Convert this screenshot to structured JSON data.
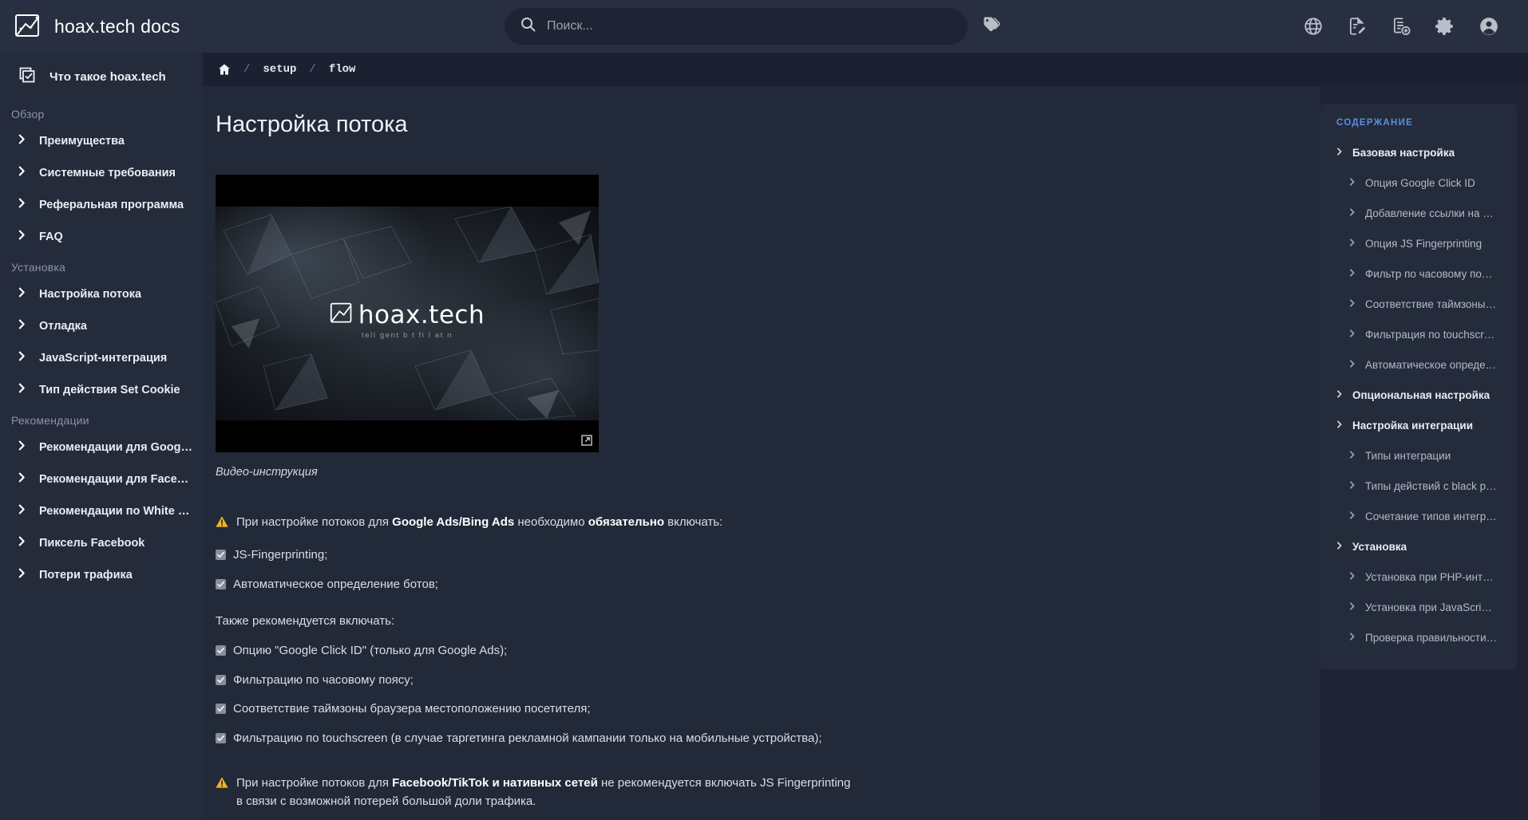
{
  "header": {
    "brand_title": "hoax.tech docs",
    "logo_icon": "image-chart-logo-icon",
    "search": {
      "placeholder": "Поиск...",
      "value": "",
      "icon": "search-icon"
    },
    "tags_icon": "tags-icon",
    "icons": [
      {
        "name": "language-globe-icon",
        "label": "Язык"
      },
      {
        "name": "edit-document-icon",
        "label": "Редактировать"
      },
      {
        "name": "add-document-icon",
        "label": "Добавить"
      },
      {
        "name": "gear-icon",
        "label": "Настройки"
      },
      {
        "name": "account-icon",
        "label": "Аккаунт"
      }
    ]
  },
  "breadcrumb": {
    "home_icon": "home-icon",
    "separator": "/",
    "items": [
      {
        "label": "setup"
      },
      {
        "label": "flow"
      }
    ]
  },
  "sidebar": {
    "top_item": {
      "label": "Что такое hoax.tech",
      "icon": "checklist-icon"
    },
    "sections": [
      {
        "label": "Обзор",
        "items": [
          {
            "label": "Преимущества"
          },
          {
            "label": "Системные требования"
          },
          {
            "label": "Реферальная программа"
          },
          {
            "label": "FAQ"
          }
        ]
      },
      {
        "label": "Установка",
        "items": [
          {
            "label": "Настройка потока"
          },
          {
            "label": "Отладка"
          },
          {
            "label": "JavaScript-интеграция"
          },
          {
            "label": "Тип действия Set Cookie"
          }
        ]
      },
      {
        "label": "Рекомендации",
        "items": [
          {
            "label": "Рекомендации для Google A…"
          },
          {
            "label": "Рекомендации для Facebook"
          },
          {
            "label": "Рекомендации по White Page"
          },
          {
            "label": "Пиксель Facebook"
          },
          {
            "label": "Потери трафика"
          }
        ]
      }
    ]
  },
  "main": {
    "page_title": "Настройка потока",
    "video": {
      "logo_text": "hoax.tech",
      "logo_subtitle": "tell gent b  t  fi l at  n",
      "external_link_icon": "external-link-icon",
      "caption": "Видео-инструкция"
    },
    "note_required": {
      "icon": "warning-icon",
      "prefix": "При настройке потоков для ",
      "bold1": "Google Ads/Bing Ads",
      "middle": " необходимо ",
      "bold2": "обязательно",
      "suffix": " включать:"
    },
    "required_items": [
      {
        "label": "JS-Fingerprinting;",
        "checked": true
      },
      {
        "label": "Автоматическое определение ботов;",
        "checked": true
      }
    ],
    "recommended_heading": "Также рекомендуется включать:",
    "recommended_items": [
      {
        "label": "Опцию \"Google Click ID\" (только для Google Ads);",
        "checked": true
      },
      {
        "label": "Фильтрацию по часовому поясу;",
        "checked": true
      },
      {
        "label": "Соответствие таймзоны браузера местоположению посетителя;",
        "checked": true
      },
      {
        "label": "Фильтрацию по touchscreen (в случае таргетинга рекламной кампании только на мобильные устройства);",
        "checked": true
      }
    ],
    "note_facebook": {
      "icon": "warning-icon",
      "prefix": "При настройке потоков для ",
      "bold1": "Facebook/TikTok и нативных сетей",
      "suffix": " не рекомендуется включать JS Fingerprinting в связи с возможной потерей большой доли трафика."
    }
  },
  "toc": {
    "title": "СОДЕРЖАНИЕ",
    "items": [
      {
        "label": "Базовая настройка",
        "level": 1
      },
      {
        "label": "Опция Google Click ID",
        "level": 2
      },
      {
        "label": "Добавление ссылки на …",
        "level": 2
      },
      {
        "label": "Опция JS Fingerprinting",
        "level": 2
      },
      {
        "label": "Фильтр по часовому по…",
        "level": 2
      },
      {
        "label": "Соответствие таймзоны…",
        "level": 2
      },
      {
        "label": "Фильтрация по touchscr…",
        "level": 2
      },
      {
        "label": "Автоматическое опреде…",
        "level": 2
      },
      {
        "label": "Опциональная настройка",
        "level": 1
      },
      {
        "label": "Настройка интеграции",
        "level": 1
      },
      {
        "label": "Типы интеграции",
        "level": 2
      },
      {
        "label": "Типы действий с black p…",
        "level": 2
      },
      {
        "label": "Сочетание типов интегр…",
        "level": 2
      },
      {
        "label": "Установка",
        "level": 1
      },
      {
        "label": "Установка при PHP-инт…",
        "level": 2
      },
      {
        "label": "Установка при JavaScri…",
        "level": 2
      },
      {
        "label": "Проверка правильности…",
        "level": 2
      }
    ]
  },
  "colors": {
    "header_bg": "#282f40",
    "sidebar_bg": "#242b3b",
    "main_bg": "#222938",
    "page_bg": "#1e2433",
    "accent": "#5b8fe0",
    "warning": "#f0b429",
    "text": "#e9edf4"
  }
}
